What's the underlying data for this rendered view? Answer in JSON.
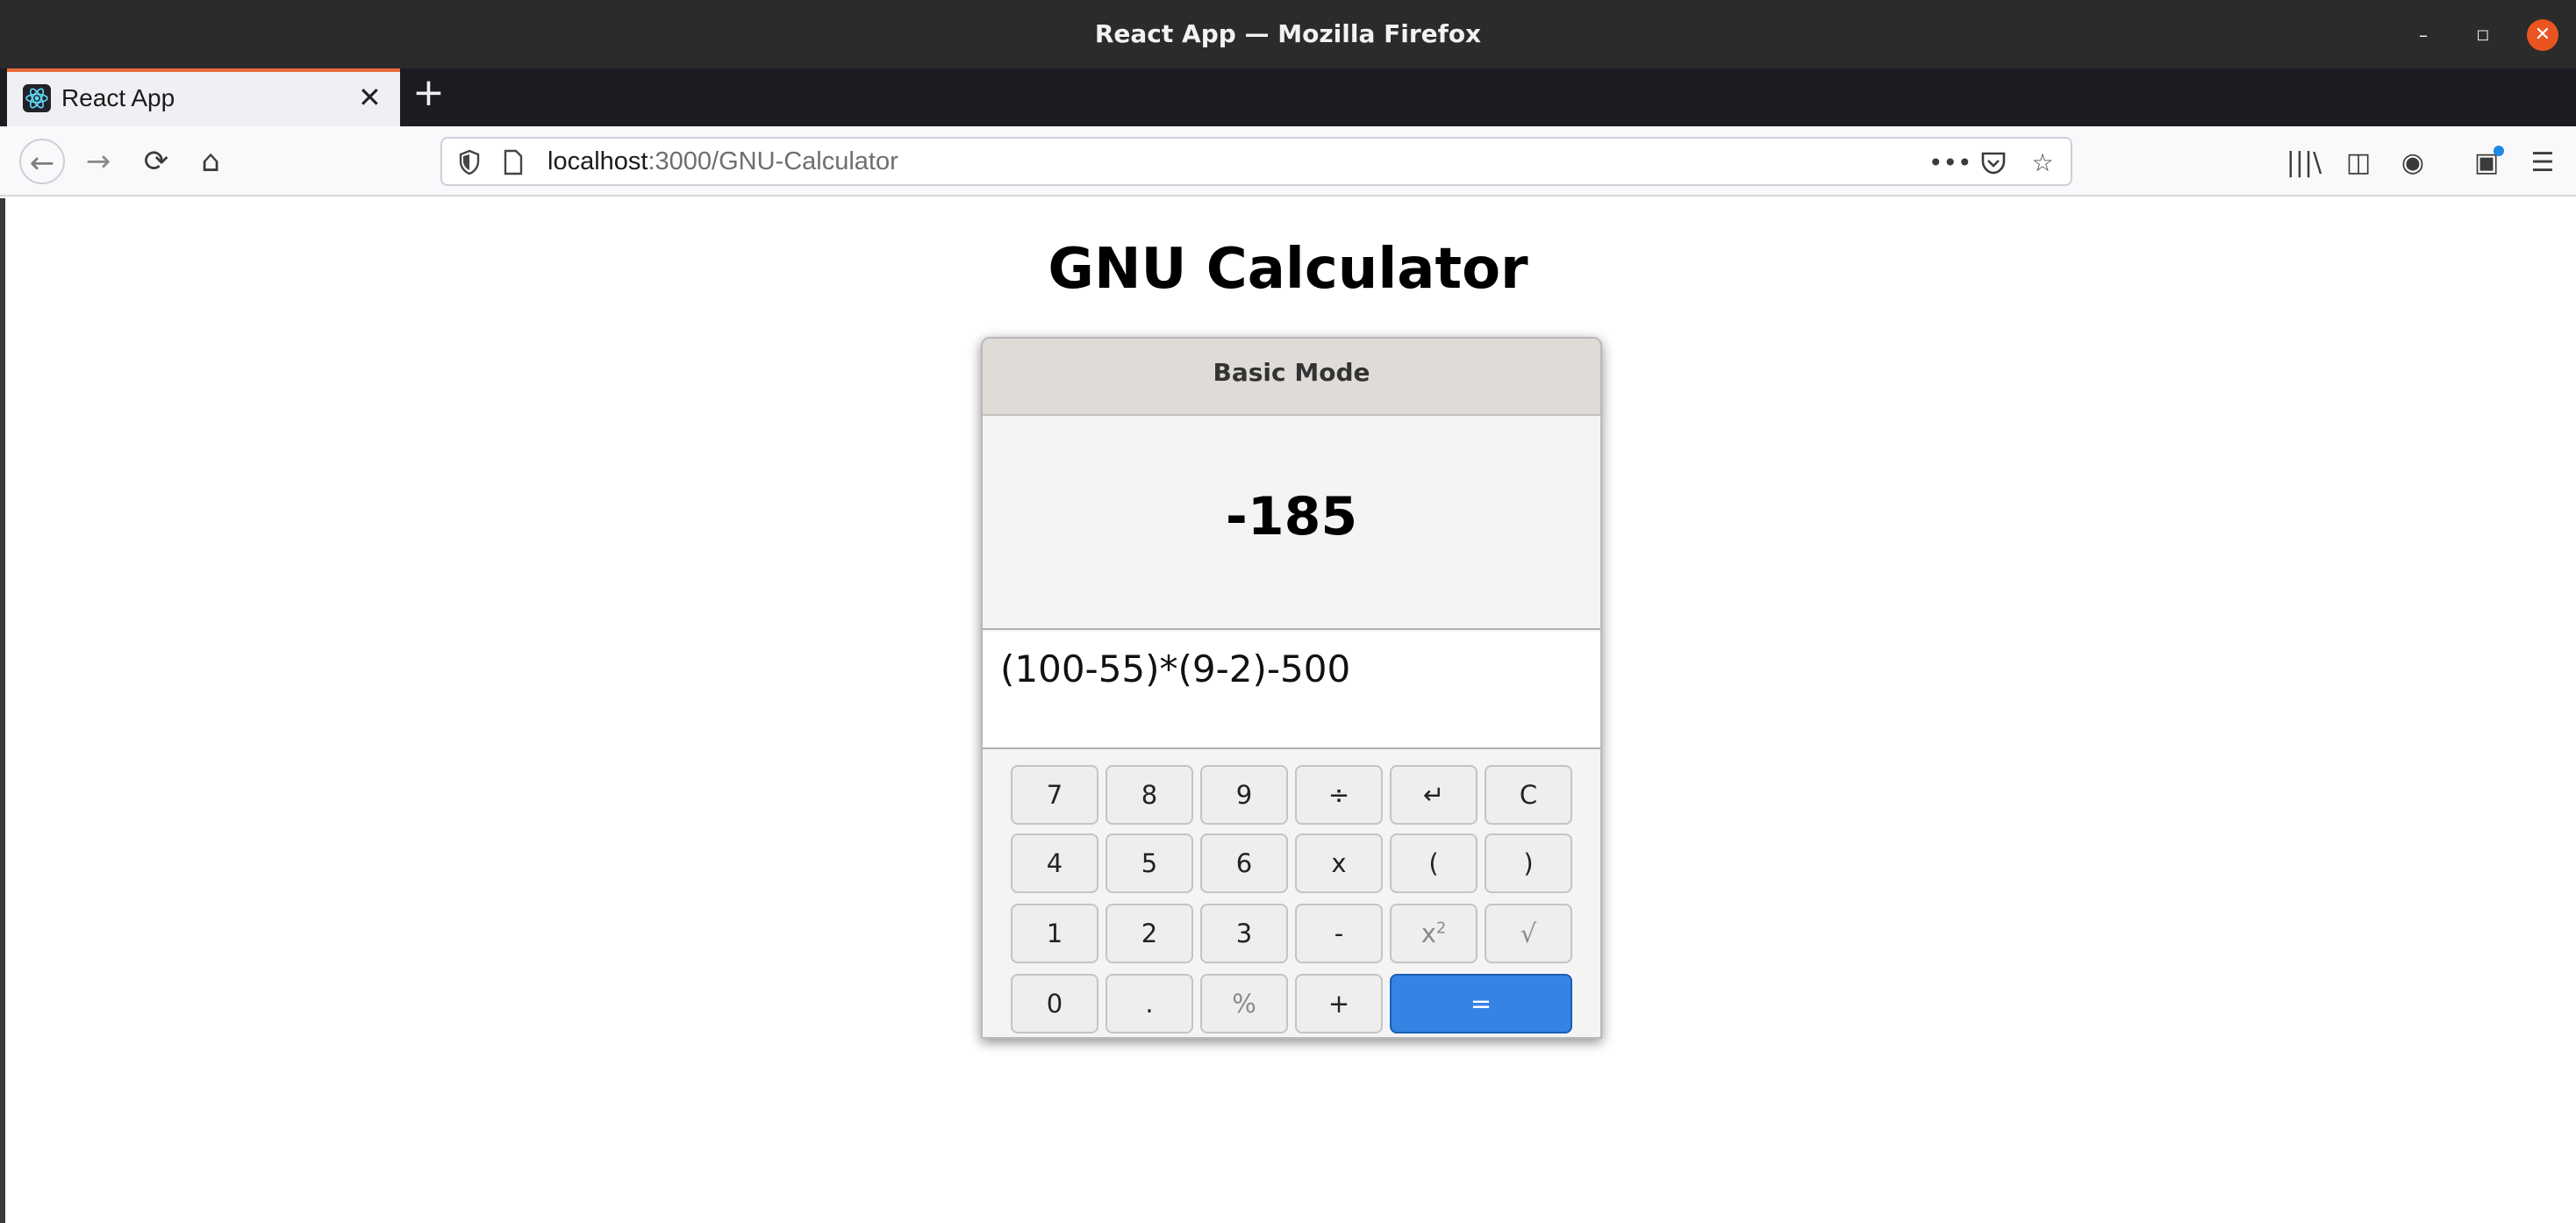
{
  "window": {
    "title": "React App — Mozilla Firefox",
    "minimize": "–",
    "maximize": "◻",
    "close": "✕"
  },
  "tabs": [
    {
      "label": "React App",
      "close": "✕"
    }
  ],
  "new_tab": "+",
  "navbar": {
    "back": "←",
    "forward": "→",
    "reload": "⟳",
    "home": "⌂",
    "url_host": "localhost",
    "url_path": ":3000/GNU-Calculator",
    "page_actions": "•••",
    "pocket": "◡",
    "bookmark": "☆",
    "library": "|||\\",
    "sidebar": "◫",
    "account": "◉",
    "gift": "▣",
    "menu": "☰"
  },
  "page": {
    "title": "GNU Calculator"
  },
  "calculator": {
    "mode": "Basic Mode",
    "result": "-185",
    "expression": "(100-55)*(9-2)-500",
    "keys": {
      "k7": "7",
      "k8": "8",
      "k9": "9",
      "div": "÷",
      "undo": "↵",
      "clear": "C",
      "k4": "4",
      "k5": "5",
      "k6": "6",
      "mul": "x",
      "lparen": "(",
      "rparen": ")",
      "k1": "1",
      "k2": "2",
      "k3": "3",
      "sub": "-",
      "square_base": "x",
      "square_exp": "2",
      "sqrt": "√",
      "k0": "0",
      "dot": ".",
      "percent": "%",
      "add": "+",
      "equals": "="
    }
  },
  "colors": {
    "accent": "#3584e4",
    "tab_highlight": "#e66b3a",
    "close_button": "#e95420"
  }
}
